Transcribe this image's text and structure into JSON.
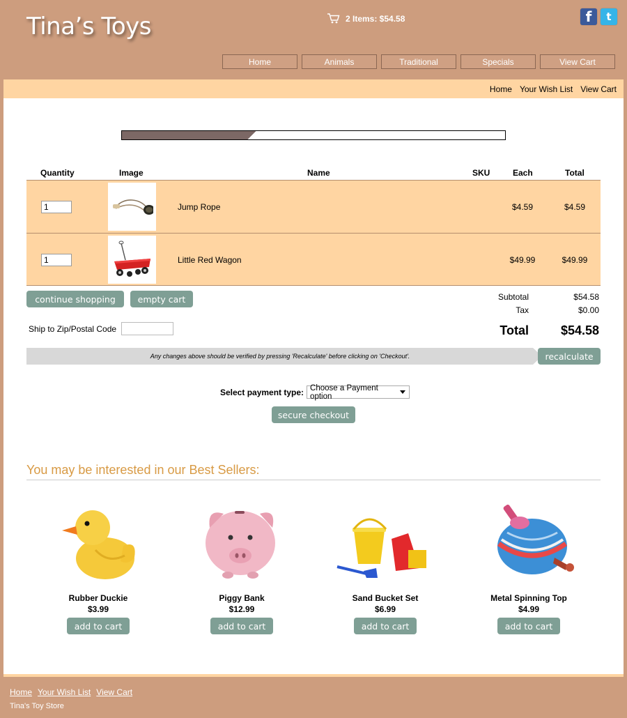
{
  "header": {
    "logo": "Tina’s Toys",
    "cart_summary": "2 Items: $54.58",
    "social": {
      "facebook": "f",
      "twitter": "t"
    }
  },
  "nav": [
    "Home",
    "Animals",
    "Traditional",
    "Specials",
    "View Cart"
  ],
  "subnav": [
    "Home",
    "Your Wish List",
    "View Cart"
  ],
  "checkout_progress": 0.35,
  "cart": {
    "columns": {
      "quantity": "Quantity",
      "image": "Image",
      "name": "Name",
      "sku": "SKU",
      "each": "Each",
      "total": "Total"
    },
    "items": [
      {
        "qty": "1",
        "name": "Jump Rope",
        "sku": "",
        "each": "$4.59",
        "total": "$4.59"
      },
      {
        "qty": "1",
        "name": "Little Red Wagon",
        "sku": "",
        "each": "$49.99",
        "total": "$49.99"
      }
    ],
    "continue_label": "continue shopping",
    "empty_label": "empty cart",
    "zip_label": "Ship to Zip/Postal Code",
    "zip_value": "",
    "subtotal_label": "Subtotal",
    "subtotal": "$54.58",
    "tax_label": "Tax",
    "tax": "$0.00",
    "total_label": "Total",
    "total": "$54.58",
    "recalc_note": "Any changes above should be verified by pressing 'Recalculate' before clicking on 'Checkout'.",
    "recalc_label": "recalculate"
  },
  "payment": {
    "label": "Select payment type:",
    "selected": "Choose a Payment option",
    "checkout_label": "secure checkout"
  },
  "bestsellers": {
    "title": "You may be interested in our Best Sellers:",
    "add_label": "add to cart",
    "items": [
      {
        "name": "Rubber Duckie",
        "price": "$3.99"
      },
      {
        "name": "Piggy Bank",
        "price": "$12.99"
      },
      {
        "name": "Sand Bucket Set",
        "price": "$6.99"
      },
      {
        "name": "Metal Spinning Top",
        "price": "$4.99"
      }
    ]
  },
  "footer": {
    "links": [
      "Home",
      "Your Wish List",
      "View Cart"
    ],
    "store": "Tina's Toy Store"
  },
  "colors": {
    "background": "#cd9d7e",
    "band": "#ffd5a2",
    "button": "#7f9f95",
    "heading": "#d89a44",
    "progress": "#7c6865"
  }
}
